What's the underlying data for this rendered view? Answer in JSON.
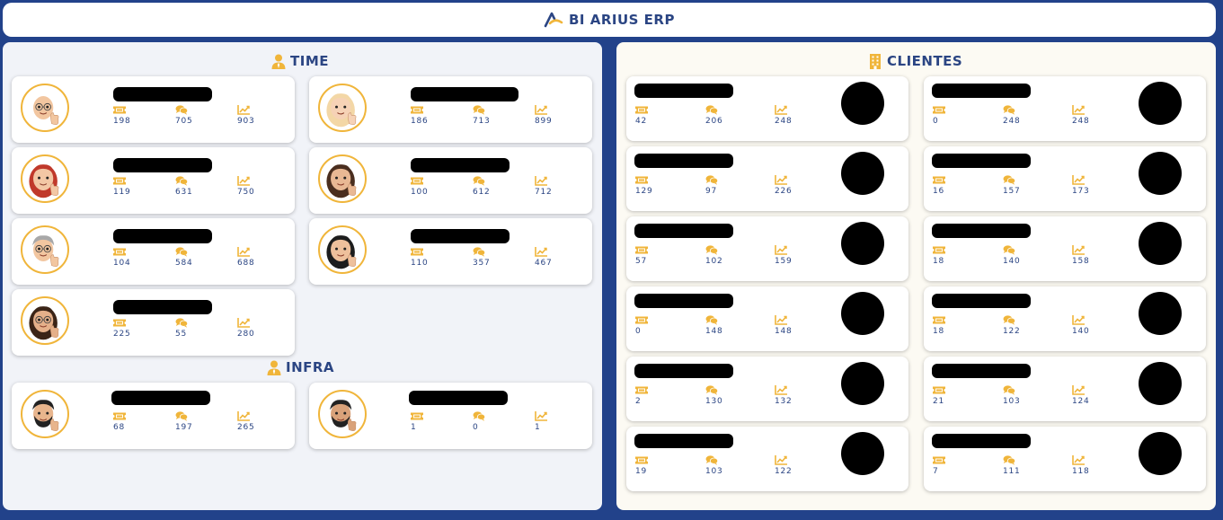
{
  "header": {
    "title": "BI ARIUS ERP",
    "logo_icon": "arius-logo-icon"
  },
  "time": {
    "title": "TIME",
    "icon": "user-tie-icon",
    "members": [
      {
        "avatar": "memoji-bald-glasses",
        "v1": "198",
        "v2": "705",
        "v3": "903"
      },
      {
        "avatar": "memoji-blonde",
        "v1": "186",
        "v2": "713",
        "v3": "899"
      },
      {
        "avatar": "memoji-red-hair",
        "v1": "119",
        "v2": "631",
        "v3": "750"
      },
      {
        "avatar": "memoji-brown-hair",
        "v1": "100",
        "v2": "612",
        "v3": "712"
      },
      {
        "avatar": "memoji-gray-hair",
        "v1": "104",
        "v2": "584",
        "v3": "688"
      },
      {
        "avatar": "memoji-black-hair",
        "v1": "110",
        "v2": "357",
        "v3": "467"
      },
      {
        "avatar": "memoji-curly-glasses",
        "v1": "225",
        "v2": "55",
        "v3": "280"
      }
    ]
  },
  "infra": {
    "title": "INFRA",
    "icon": "user-tie-icon",
    "members": [
      {
        "avatar": "memoji-beard",
        "v1": "68",
        "v2": "197",
        "v3": "265"
      },
      {
        "avatar": "memoji-beard-2",
        "v1": "1",
        "v2": "0",
        "v3": "1"
      }
    ]
  },
  "clientes": {
    "title": "CLIENTES",
    "icon": "building-icon",
    "items": [
      {
        "v1": "42",
        "v2": "206",
        "v3": "248"
      },
      {
        "v1": "0",
        "v2": "248",
        "v3": "248"
      },
      {
        "v1": "129",
        "v2": "97",
        "v3": "226"
      },
      {
        "v1": "16",
        "v2": "157",
        "v3": "173"
      },
      {
        "v1": "57",
        "v2": "102",
        "v3": "159"
      },
      {
        "v1": "18",
        "v2": "140",
        "v3": "158"
      },
      {
        "v1": "0",
        "v2": "148",
        "v3": "148"
      },
      {
        "v1": "18",
        "v2": "122",
        "v3": "140"
      },
      {
        "v1": "2",
        "v2": "130",
        "v3": "132"
      },
      {
        "v1": "21",
        "v2": "103",
        "v3": "124"
      },
      {
        "v1": "19",
        "v2": "103",
        "v3": "122"
      },
      {
        "v1": "7",
        "v2": "111",
        "v3": "118"
      }
    ]
  },
  "stat_icons": [
    "ticket-icon",
    "comments-icon",
    "chart-line-icon"
  ],
  "colors": {
    "background": "#22428a",
    "accent": "#f0b53a",
    "text": "#2b4583"
  }
}
